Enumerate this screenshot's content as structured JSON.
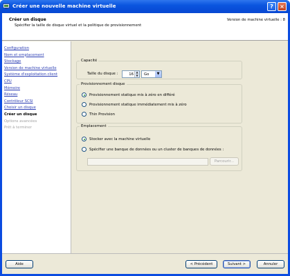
{
  "window": {
    "title": "Créer une nouvelle machine virtuelle",
    "help_glyph": "?",
    "close_glyph": "×"
  },
  "header": {
    "title": "Créer un disque",
    "subtitle": "Spécifier la taille de disque virtuel et la politique de provisionnement",
    "version": "Version de machine virtuelle : 8"
  },
  "steps": [
    {
      "label": "Configuration",
      "state": "link"
    },
    {
      "label": "Nom et emplacement",
      "state": "link"
    },
    {
      "label": "Stockage",
      "state": "link"
    },
    {
      "label": "Version de machine virtuelle",
      "state": "link"
    },
    {
      "label": "Système d'exploitation client",
      "state": "link"
    },
    {
      "label": "CPU",
      "state": "link"
    },
    {
      "label": "Mémoire",
      "state": "link"
    },
    {
      "label": "Réseau",
      "state": "link"
    },
    {
      "label": "Contrôleur SCSI",
      "state": "link"
    },
    {
      "label": "Choisir un disque",
      "state": "link"
    },
    {
      "label": "Créer un disque",
      "state": "current"
    },
    {
      "label": "Options avancées",
      "state": "disabled"
    },
    {
      "label": "Prêt à terminer",
      "state": "disabled"
    }
  ],
  "capacity": {
    "legend": "Capacité",
    "size_label": "Taille du disque :",
    "size_value": "16",
    "unit_value": "Go",
    "spin_up": "▲",
    "spin_down": "▼",
    "dropdown_arrow": "▼"
  },
  "provisioning": {
    "legend": "Provisionnement disque",
    "options": [
      {
        "label": "Provisionnement statique mis à zéro en différé",
        "selected": true
      },
      {
        "label": "Provisionnement statique immédiatement mis à zéro",
        "selected": false
      },
      {
        "label": "Thin Provision",
        "selected": false
      }
    ]
  },
  "location": {
    "legend": "Emplacement",
    "options": [
      {
        "label": "Stocker avec la machine virtuelle",
        "selected": true
      },
      {
        "label": "Spécifier une banque de données ou un cluster de banques de données :",
        "selected": false
      }
    ],
    "datastore_value": "",
    "browse_label": "Parcourir..."
  },
  "footer": {
    "help_label": "Aide",
    "prev_label": "< Précédent",
    "next_label": "Suivant >",
    "cancel_label": "Annuler"
  },
  "colors": {
    "titlebar": "#0a55df",
    "link": "#2a3cb3",
    "client_bg": "#ece9d8"
  }
}
